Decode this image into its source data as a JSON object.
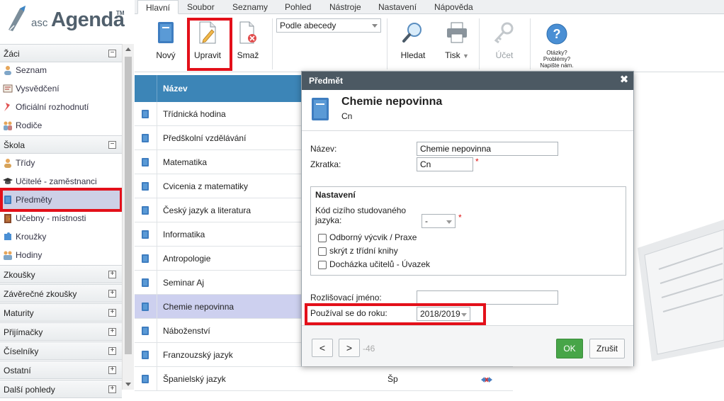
{
  "logo": {
    "prefix": "asc",
    "name": "Agenda",
    "tm": "TM"
  },
  "tabs": [
    "Hlavní",
    "Soubor",
    "Seznamy",
    "Pohled",
    "Nástroje",
    "Nastavení",
    "Nápověda"
  ],
  "ribbon": {
    "new_label": "Nový",
    "edit_label": "Upravit",
    "delete_label": "Smaž",
    "sort_value": "Podle abecedy",
    "search_label": "Hledat",
    "print_label": "Tisk",
    "account_label": "Účet",
    "help_lines": [
      "Otázky?",
      "Problémy?",
      "Napište nám."
    ]
  },
  "sidebar": {
    "sections": [
      {
        "label": "Žáci",
        "expanded": true,
        "items": [
          "Seznam",
          "Vysvědčení",
          "Oficiální rozhodnutí",
          "Rodiče"
        ]
      },
      {
        "label": "Škola",
        "expanded": true,
        "items": [
          "Třídy",
          "Učitelé - zaměstnanci",
          "Předměty",
          "Učebny - místnosti",
          "Kroužky",
          "Hodiny"
        ]
      },
      {
        "label": "Zkoušky",
        "expanded": false
      },
      {
        "label": "Závěrečné zkoušky",
        "expanded": false
      },
      {
        "label": "Maturity",
        "expanded": false
      },
      {
        "label": "Přijímačky",
        "expanded": false
      },
      {
        "label": "Číselníky",
        "expanded": false
      },
      {
        "label": "Ostatní",
        "expanded": false
      },
      {
        "label": "Další pohledy",
        "expanded": false
      }
    ],
    "selected": "Předměty"
  },
  "grid": {
    "header_name": "Název",
    "rows": [
      {
        "name": "Třídnická hodina"
      },
      {
        "name": "Předškolní vzdělávání"
      },
      {
        "name": "Matematika"
      },
      {
        "name": "Cvicenia z matematiky"
      },
      {
        "name": "Český jazyk a literatura"
      },
      {
        "name": "Informatika"
      },
      {
        "name": "Antropologie"
      },
      {
        "name": "Seminar Aj"
      },
      {
        "name": "Chemie nepovinna",
        "selected": true
      },
      {
        "name": "Náboženství"
      },
      {
        "name": "Franzouzský jazyk"
      },
      {
        "name": "Španielský jazyk",
        "abbr": "Šp"
      }
    ]
  },
  "modal": {
    "header": "Předmět",
    "title": "Chemie nepovinna",
    "subtitle": "Cn",
    "name_label": "Název:",
    "name_value": "Chemie nepovinna",
    "abbr_label": "Zkratka:",
    "abbr_value": "Cn",
    "required_mark": "*",
    "settings_legend": "Nastavení",
    "foreign_lang_label_1": "Kód cizího studovaného",
    "foreign_lang_label_2": "jazyka:",
    "foreign_lang_value": "-",
    "checkboxes": [
      "Odborný výcvik / Praxe",
      "skrýt z třídní knihy",
      "Docházka učitelů - Úvazek"
    ],
    "distinct_name_label": "Rozlišovací jméno:",
    "distinct_name_value": "",
    "used_until_label": "Používal se do roku:",
    "used_until_value": "2018/2019",
    "nav_prev": "<",
    "nav_next": ">",
    "record_id": "-46",
    "ok_label": "OK",
    "cancel_label": "Zrušit"
  },
  "colors": {
    "grid_header": "#3c85b7",
    "selection": "#cdd0ef",
    "modal_header": "#4c5963",
    "ok_button": "#47a548",
    "highlight_box": "#e3101a"
  }
}
